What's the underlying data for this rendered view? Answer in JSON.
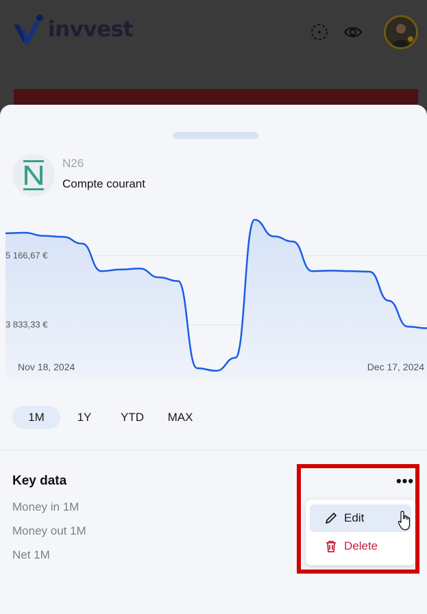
{
  "app": {
    "logo_text": "invvest"
  },
  "account": {
    "bank": "N26",
    "name": "Compte courant"
  },
  "chart_data": {
    "type": "area",
    "x_labels": [
      "Nov 18, 2024",
      "Dec 17, 2024"
    ],
    "y_ticks": [
      "5 166,67 €",
      "3 833,33 €"
    ],
    "y_tick_values": [
      5166.67,
      3833.33
    ],
    "ylim": [
      2800,
      5900
    ],
    "series": [
      {
        "values": [
          5600,
          5610,
          5550,
          5530,
          5400,
          4870,
          4900,
          4920,
          4750,
          4680,
          3000,
          2950,
          3200,
          5860,
          5540,
          5440,
          4870,
          4880,
          4870,
          4860,
          4300,
          3800,
          3770
        ]
      }
    ],
    "line_color": "#1a5ce6",
    "grid": true
  },
  "range_tabs": [
    {
      "label": "1M",
      "active": true
    },
    {
      "label": "1Y",
      "active": false
    },
    {
      "label": "YTD",
      "active": false
    },
    {
      "label": "MAX",
      "active": false
    }
  ],
  "key_data": {
    "title": "Key data",
    "rows": [
      "Money in 1M",
      "Money out 1M",
      "Net 1M"
    ]
  },
  "menu": {
    "more_label": "•••",
    "edit": "Edit",
    "delete": "Delete"
  },
  "colors": {
    "accent": "#1a5ce6",
    "danger": "#c4203d",
    "highlight": "#d10000"
  }
}
